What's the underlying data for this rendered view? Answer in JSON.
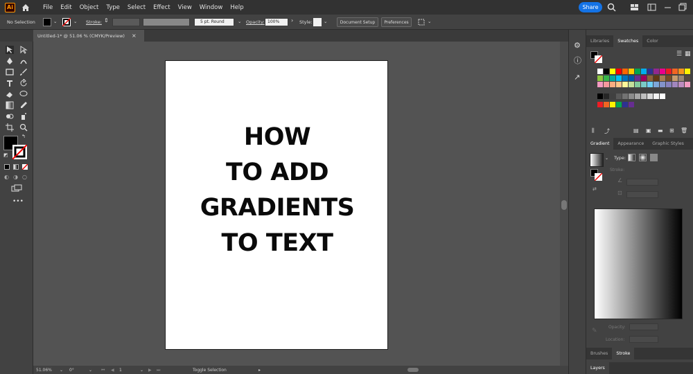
{
  "app": {
    "logo": "Ai",
    "share_label": "Share"
  },
  "menus": [
    "File",
    "Edit",
    "Object",
    "Type",
    "Select",
    "Effect",
    "View",
    "Window",
    "Help"
  ],
  "control": {
    "selection": "No Selection",
    "stroke_label": "Stroke:",
    "brush_value": "5 pt. Round",
    "opacity_label": "Opacity:",
    "opacity_value": "100%",
    "style_label": "Style:",
    "doc_setup": "Document Setup",
    "preferences": "Preferences"
  },
  "doc_tab": {
    "title": "Untitled-1* @ 51.06 % (CMYK/Preview)",
    "close": "×"
  },
  "artboard": {
    "lines": [
      "HOW",
      "TO ADD",
      "GRADIENTS",
      "TO TEXT"
    ]
  },
  "status": {
    "zoom": "51.06%",
    "rotate": "0°",
    "artboard": "1",
    "mode": "Toggle Selection"
  },
  "panels": {
    "top_tabs": [
      "Libraries",
      "Swatches",
      "Color"
    ],
    "mid_tabs": [
      "Gradient",
      "Appearance",
      "Graphic Styles"
    ],
    "type_label": "Type:",
    "stroke_label": "Stroke:",
    "opacity_label": "Opacity:",
    "location_label": "Location:",
    "bottom_tabs": [
      "Brushes",
      "Stroke"
    ],
    "layers_tab": "Layers"
  },
  "swatch_rows": [
    [
      "#ffffff",
      "#000000",
      "#ffff00",
      "#ff0000",
      "#ff6600",
      "#ffcc00",
      "#00a651",
      "#00aeef",
      "#2e3192",
      "#92278f",
      "#ec008c",
      "#ed1c24",
      "#f26522",
      "#f7941d",
      "#fff200"
    ],
    [
      "#8dc63f",
      "#39b54a",
      "#00a99d",
      "#00bff3",
      "#0072bc",
      "#0054a6",
      "#662d91",
      "#9e005d",
      "#8c6239",
      "#603913",
      "#a67c52",
      "#754c24",
      "#c69c6d",
      "#998675",
      "#534741"
    ],
    [
      "#f49ac1",
      "#f6989d",
      "#f9ad81",
      "#fdc689",
      "#fff799",
      "#c4df9b",
      "#82ca9c",
      "#7accc8",
      "#6dcff6",
      "#7da7d9",
      "#8393ca",
      "#8781bd",
      "#a186be",
      "#bd8cbf",
      "#f49bc1"
    ],
    [
      "#000000",
      "#262626",
      "#404040",
      "#595959",
      "#737373",
      "#8c8c8c",
      "#a6a6a6",
      "#bfbfbf",
      "#d9d9d9",
      "#f2f2f2",
      "#ffffff"
    ],
    [
      "#ed1c24",
      "#f26522",
      "#fff200",
      "#00a651",
      "#2e3192",
      "#662d91"
    ]
  ]
}
